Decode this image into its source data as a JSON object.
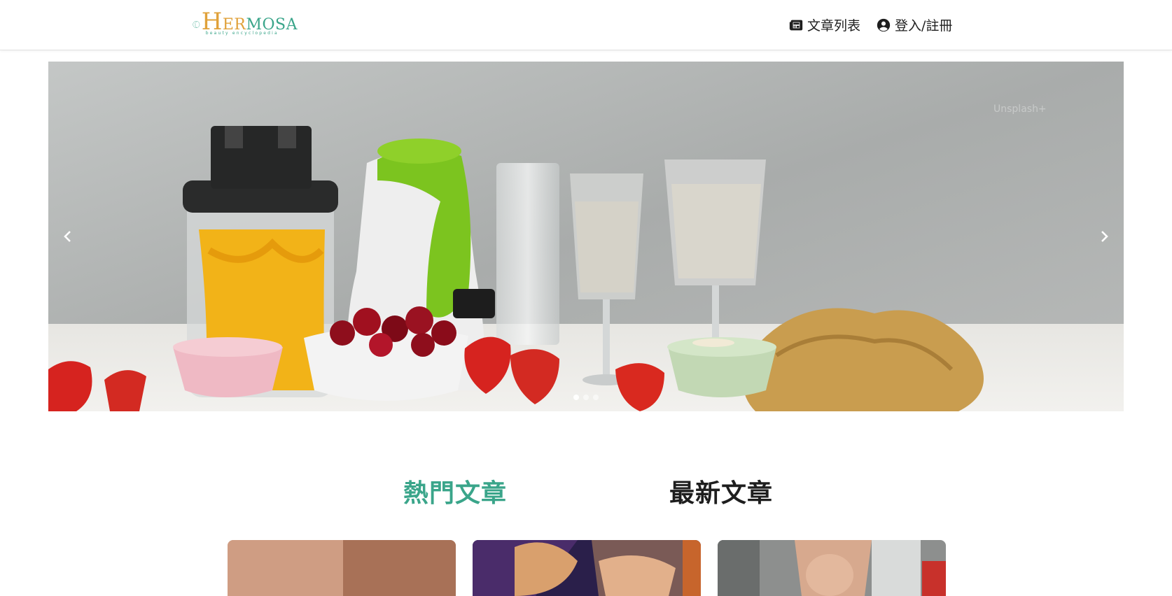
{
  "header": {
    "logo": {
      "brand_first": "H",
      "brand_rest": "ER",
      "brand_tail": "MOSA",
      "tagline": "beauty encyclopedia"
    },
    "nav": [
      {
        "label": "文章列表",
        "icon": "newspaper-icon"
      },
      {
        "label": "登入/註冊",
        "icon": "user-circle-icon"
      }
    ]
  },
  "carousel": {
    "slide_count": 3,
    "active_index": 0,
    "image": "food-smoothie-scene",
    "watermark": "Unsplash+",
    "prev_icon": "chevron-left-icon",
    "next_icon": "chevron-right-icon"
  },
  "tabs": [
    {
      "label": "熱門文章",
      "active": true
    },
    {
      "label": "最新文章",
      "active": false
    }
  ],
  "cards": [
    {
      "image": "skin-texture-image"
    },
    {
      "image": "women-portrait-image"
    },
    {
      "image": "woman-skin-care-image"
    }
  ],
  "colors": {
    "accent": "#3aa58a",
    "logo_gold": "#e0a13a",
    "text": "#1e1e1e"
  }
}
